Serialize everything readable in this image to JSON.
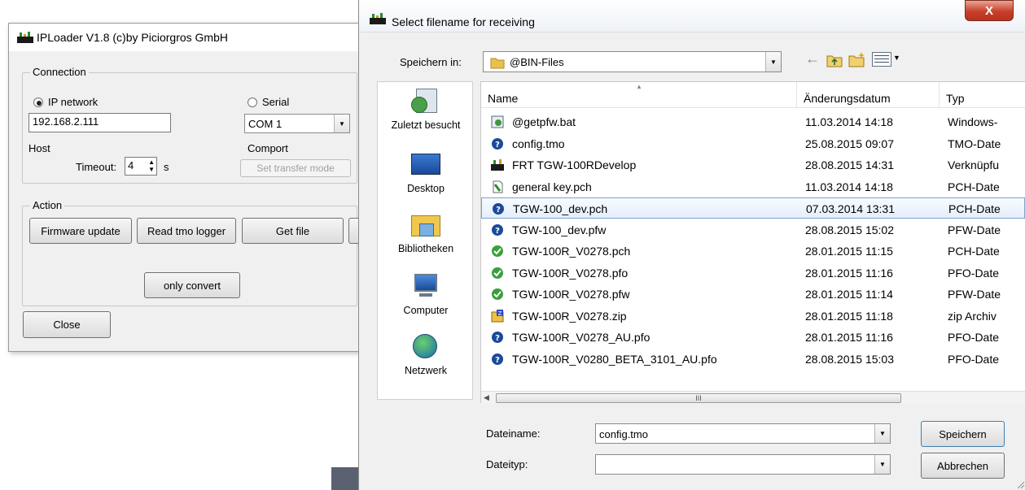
{
  "iploader": {
    "title": "IPLoader V1.8 (c)by Piciorgros GmbH",
    "connection_label": "Connection",
    "ip_network_label": "IP network",
    "serial_label": "Serial",
    "ip_value": "192.168.2.111",
    "comport_value": "COM 1",
    "host_label": "Host",
    "comport_label": "Comport",
    "timeout_label": "Timeout:",
    "timeout_value": "4",
    "timeout_unit": "s",
    "set_transfer_mode": "Set transfer mode",
    "action_label": "Action",
    "firmware_update": "Firmware update",
    "read_tmo_logger": "Read tmo logger",
    "get_file": "Get file",
    "only_convert": "only convert",
    "close": "Close"
  },
  "dialog": {
    "title": "Select filename for receiving",
    "save_in_label": "Speichern in:",
    "save_in_value": "@BIN-Files",
    "places": [
      {
        "label": "Zuletzt besucht",
        "icon": "recent-places-icon"
      },
      {
        "label": "Desktop",
        "icon": "desktop-icon"
      },
      {
        "label": "Bibliotheken",
        "icon": "libraries-icon"
      },
      {
        "label": "Computer",
        "icon": "computer-icon"
      },
      {
        "label": "Netzwerk",
        "icon": "network-icon"
      }
    ],
    "columns": {
      "name": "Name",
      "date": "Änderungsdatum",
      "type": "Typ"
    },
    "files": [
      {
        "name": "@getpfw.bat",
        "date": "11.03.2014 14:18",
        "type": "Windows-",
        "icon": "batch-file-icon"
      },
      {
        "name": "config.tmo",
        "date": "25.08.2015 09:07",
        "type": "TMO-Date",
        "icon": "unknown-file-icon"
      },
      {
        "name": "FRT TGW-100RDevelop",
        "date": "28.08.2015 14:31",
        "type": "Verknüpfu",
        "icon": "shortcut-icon"
      },
      {
        "name": "general key.pch",
        "date": "11.03.2014 14:18",
        "type": "PCH-Date",
        "icon": "pch-file-icon"
      },
      {
        "name": "TGW-100_dev.pch",
        "date": "07.03.2014 13:31",
        "type": "PCH-Date",
        "icon": "unknown-file-icon"
      },
      {
        "name": "TGW-100_dev.pfw",
        "date": "28.08.2015 15:02",
        "type": "PFW-Date",
        "icon": "unknown-file-icon"
      },
      {
        "name": "TGW-100R_V0278.pch",
        "date": "28.01.2015 11:15",
        "type": "PCH-Date",
        "icon": "green-check-file-icon"
      },
      {
        "name": "TGW-100R_V0278.pfo",
        "date": "28.01.2015 11:16",
        "type": "PFO-Date",
        "icon": "green-check-file-icon"
      },
      {
        "name": "TGW-100R_V0278.pfw",
        "date": "28.01.2015 11:14",
        "type": "PFW-Date",
        "icon": "green-check-file-icon"
      },
      {
        "name": "TGW-100R_V0278.zip",
        "date": "28.01.2015 11:18",
        "type": "zip Archiv",
        "icon": "zip-file-icon"
      },
      {
        "name": "TGW-100R_V0278_AU.pfo",
        "date": "28.01.2015 11:16",
        "type": "PFO-Date",
        "icon": "unknown-file-icon"
      },
      {
        "name": "TGW-100R_V0280_BETA_3101_AU.pfo",
        "date": "28.08.2015 15:03",
        "type": "PFO-Date",
        "icon": "unknown-file-icon"
      }
    ],
    "scroll_grip": "III",
    "filename_label": "Dateiname:",
    "filename_value": "config.tmo",
    "filetype_label": "Dateityp:",
    "filetype_value": "",
    "save_button": "Speichern",
    "cancel_button": "Abbrechen",
    "close_glyph": "X"
  }
}
